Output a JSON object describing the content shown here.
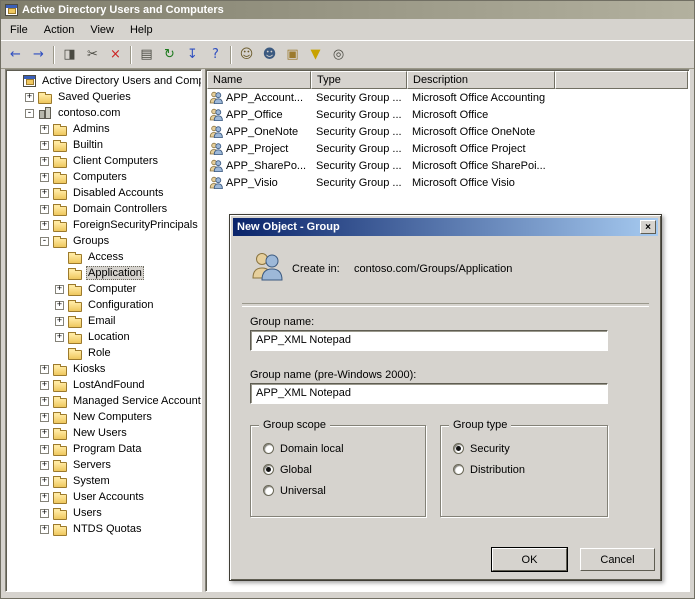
{
  "colors": {
    "chrome": "#d6d3ce",
    "titlebar_inactive_left": "#7f7d6b",
    "titlebar_inactive_right": "#b3b19f",
    "dialog_titlebar_left": "#0a246a",
    "dialog_titlebar_right": "#a6caf0",
    "folder_yellow": "#eec75e",
    "delete_red": "#cc2222"
  },
  "window": {
    "title": "Active Directory Users and Computers",
    "menu": [
      "File",
      "Action",
      "View",
      "Help"
    ]
  },
  "toolbar": {
    "buttons": [
      {
        "name": "back",
        "glyph": "←",
        "color": "#2f4fc0"
      },
      {
        "name": "forward",
        "glyph": "→",
        "color": "#2f4fc0"
      },
      {
        "sep": true
      },
      {
        "name": "show-console-tree",
        "glyph": "◨",
        "color": "#4a4a42"
      },
      {
        "name": "cut",
        "glyph": "✂",
        "color": "#4a4a42"
      },
      {
        "name": "delete",
        "glyph": "×",
        "color": "#cc2222"
      },
      {
        "sep": true
      },
      {
        "name": "properties",
        "glyph": "▤",
        "color": "#4a4a42"
      },
      {
        "name": "refresh",
        "glyph": "↻",
        "color": "#1d7a1d"
      },
      {
        "name": "export-list",
        "glyph": "↧",
        "color": "#2f4fc0"
      },
      {
        "name": "help",
        "glyph": "?",
        "color": "#2f4fc0"
      },
      {
        "sep": true
      },
      {
        "name": "new-user",
        "glyph": "☺",
        "color": "#6a5a2a"
      },
      {
        "name": "new-group",
        "glyph": "☻",
        "color": "#3c5a80"
      },
      {
        "name": "new-ou",
        "glyph": "▣",
        "color": "#9c7a2c"
      },
      {
        "name": "set-filter",
        "glyph": "▼",
        "color": "#c8a200"
      },
      {
        "name": "find-objects",
        "glyph": "◎",
        "color": "#4a4a42"
      }
    ]
  },
  "tree": {
    "items": [
      {
        "label": "Active Directory Users and Comput",
        "level": 0,
        "expander": "",
        "icon": "root",
        "selected": false
      },
      {
        "label": "Saved Queries",
        "level": 1,
        "expander": "+",
        "icon": "folder",
        "selected": false
      },
      {
        "label": "contoso.com",
        "level": 1,
        "expander": "-",
        "icon": "domain",
        "selected": false
      },
      {
        "label": "Admins",
        "level": 2,
        "expander": "+",
        "icon": "folder",
        "selected": false
      },
      {
        "label": "Builtin",
        "level": 2,
        "expander": "+",
        "icon": "folder",
        "selected": false
      },
      {
        "label": "Client Computers",
        "level": 2,
        "expander": "+",
        "icon": "folder",
        "selected": false
      },
      {
        "label": "Computers",
        "level": 2,
        "expander": "+",
        "icon": "folder",
        "selected": false
      },
      {
        "label": "Disabled Accounts",
        "level": 2,
        "expander": "+",
        "icon": "folder",
        "selected": false
      },
      {
        "label": "Domain Controllers",
        "level": 2,
        "expander": "+",
        "icon": "folder",
        "selected": false
      },
      {
        "label": "ForeignSecurityPrincipals",
        "level": 2,
        "expander": "+",
        "icon": "folder",
        "selected": false
      },
      {
        "label": "Groups",
        "level": 2,
        "expander": "-",
        "icon": "folder",
        "selected": false
      },
      {
        "label": "Access",
        "level": 3,
        "expander": "",
        "icon": "folder",
        "selected": false
      },
      {
        "label": "Application",
        "level": 3,
        "expander": "",
        "icon": "folder",
        "selected": true
      },
      {
        "label": "Computer",
        "level": 3,
        "expander": "+",
        "icon": "folder",
        "selected": false
      },
      {
        "label": "Configuration",
        "level": 3,
        "expander": "+",
        "icon": "folder",
        "selected": false
      },
      {
        "label": "Email",
        "level": 3,
        "expander": "+",
        "icon": "folder",
        "selected": false
      },
      {
        "label": "Location",
        "level": 3,
        "expander": "+",
        "icon": "folder",
        "selected": false
      },
      {
        "label": "Role",
        "level": 3,
        "expander": "",
        "icon": "folder",
        "selected": false
      },
      {
        "label": "Kiosks",
        "level": 2,
        "expander": "+",
        "icon": "folder",
        "selected": false
      },
      {
        "label": "LostAndFound",
        "level": 2,
        "expander": "+",
        "icon": "folder",
        "selected": false
      },
      {
        "label": "Managed Service Accounts",
        "level": 2,
        "expander": "+",
        "icon": "folder",
        "selected": false
      },
      {
        "label": "New Computers",
        "level": 2,
        "expander": "+",
        "icon": "folder",
        "selected": false
      },
      {
        "label": "New Users",
        "level": 2,
        "expander": "+",
        "icon": "folder",
        "selected": false
      },
      {
        "label": "Program Data",
        "level": 2,
        "expander": "+",
        "icon": "folder",
        "selected": false
      },
      {
        "label": "Servers",
        "level": 2,
        "expander": "+",
        "icon": "folder",
        "selected": false
      },
      {
        "label": "System",
        "level": 2,
        "expander": "+",
        "icon": "folder",
        "selected": false
      },
      {
        "label": "User Accounts",
        "level": 2,
        "expander": "+",
        "icon": "folder",
        "selected": false
      },
      {
        "label": "Users",
        "level": 2,
        "expander": "+",
        "icon": "folder",
        "selected": false
      },
      {
        "label": "NTDS Quotas",
        "level": 2,
        "expander": "+",
        "icon": "folder",
        "selected": false
      }
    ]
  },
  "list": {
    "columns": [
      "Name",
      "Type",
      "Description"
    ],
    "rows": [
      {
        "name": "APP_Account...",
        "type": "Security Group ...",
        "description": "Microsoft Office Accounting"
      },
      {
        "name": "APP_Office",
        "type": "Security Group ...",
        "description": "Microsoft Office"
      },
      {
        "name": "APP_OneNote",
        "type": "Security Group ...",
        "description": "Microsoft Office OneNote"
      },
      {
        "name": "APP_Project",
        "type": "Security Group ...",
        "description": "Microsoft Office Project"
      },
      {
        "name": "APP_SharePo...",
        "type": "Security Group ...",
        "description": "Microsoft Office SharePoi..."
      },
      {
        "name": "APP_Visio",
        "type": "Security Group ...",
        "description": "Microsoft Office Visio"
      }
    ]
  },
  "dialog": {
    "title": "New Object - Group",
    "close_glyph": "×",
    "create_in_label": "Create in:",
    "create_in_value": "contoso.com/Groups/Application",
    "group_name_label": "Group name:",
    "group_name_value": "APP_XML Notepad",
    "pre_windows_label": "Group name (pre-Windows 2000):",
    "pre_windows_value": "APP_XML Notepad",
    "group_scope": {
      "label": "Group scope",
      "options": [
        {
          "label": "Domain local",
          "checked": false
        },
        {
          "label": "Global",
          "checked": true
        },
        {
          "label": "Universal",
          "checked": false
        }
      ]
    },
    "group_type": {
      "label": "Group type",
      "options": [
        {
          "label": "Security",
          "checked": true
        },
        {
          "label": "Distribution",
          "checked": false
        }
      ]
    },
    "ok_label": "OK",
    "cancel_label": "Cancel"
  }
}
